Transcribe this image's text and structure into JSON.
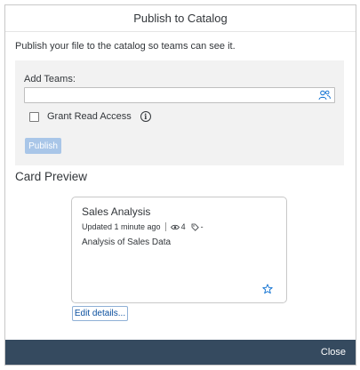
{
  "dialog": {
    "title": "Publish to Catalog",
    "intro": "Publish your file to the catalog so teams can see it."
  },
  "form": {
    "add_teams_label": "Add Teams:",
    "add_teams_value": "",
    "users_icon": "users-icon",
    "grant_read_label": "Grant Read Access",
    "grant_read_checked": false,
    "info_icon": "info-icon",
    "publish_label": "Publish"
  },
  "preview": {
    "section_title": "Card Preview",
    "card": {
      "title": "Sales Analysis",
      "updated": "Updated 1 minute ago",
      "views_count": "4",
      "tags_value": "-",
      "description": "Analysis of Sales Data",
      "favorite_icon": "star-icon"
    },
    "edit_label": "Edit details..."
  },
  "footer": {
    "close_label": "Close"
  },
  "colors": {
    "footer_bg": "#354a5f",
    "publish_disabled": "#a9c6e8",
    "link_blue": "#0a4f9e",
    "panel_bg": "#f2f2f2"
  }
}
